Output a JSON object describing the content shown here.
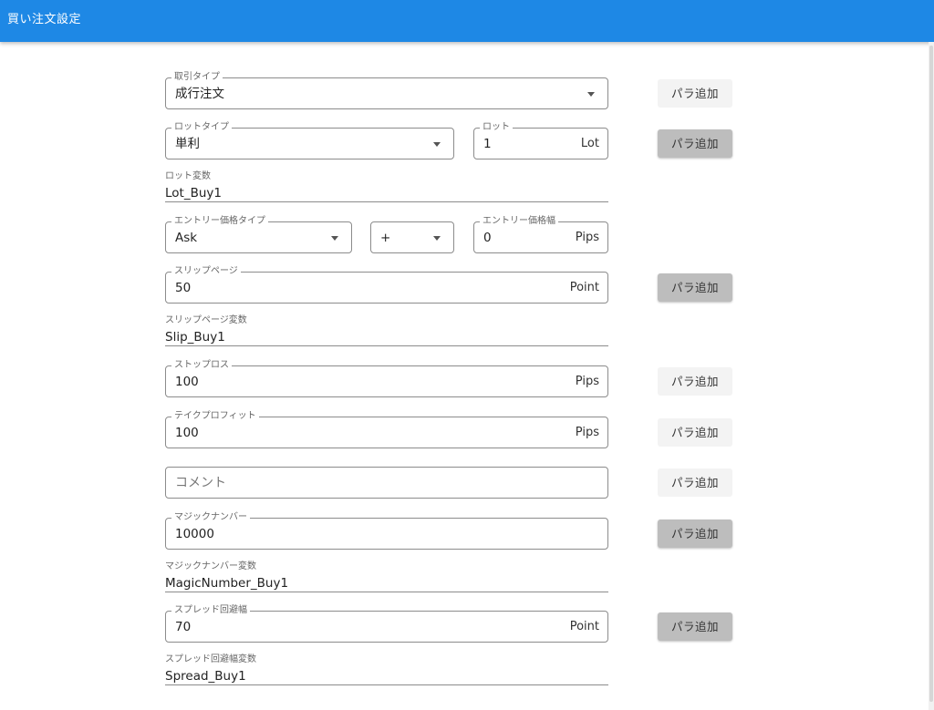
{
  "header": {
    "title": "買い注文設定"
  },
  "para_button_label": "パラ追加",
  "fields": {
    "trade_type": {
      "label": "取引タイプ",
      "value": "成行注文"
    },
    "lot_type": {
      "label": "ロットタイプ",
      "value": "単利"
    },
    "lot": {
      "label": "ロット",
      "value": "1",
      "suffix": "Lot"
    },
    "lot_variable": {
      "label": "ロット変数",
      "value": "Lot_Buy1"
    },
    "entry_price_type": {
      "label": "エントリー価格タイプ",
      "value": "Ask"
    },
    "sign": {
      "value": "+"
    },
    "entry_price_width": {
      "label": "エントリー価格幅",
      "value": "0",
      "suffix": "Pips"
    },
    "slippage": {
      "label": "スリップページ",
      "value": "50",
      "suffix": "Point"
    },
    "slippage_variable": {
      "label": "スリップページ変数",
      "value": "Slip_Buy1"
    },
    "stop_loss": {
      "label": "ストップロス",
      "value": "100",
      "suffix": "Pips"
    },
    "take_profit": {
      "label": "テイクプロフィット",
      "value": "100",
      "suffix": "Pips"
    },
    "comment": {
      "placeholder": "コメント"
    },
    "magic_number": {
      "label": "マジックナンバー",
      "value": "10000"
    },
    "magic_number_variable": {
      "label": "マジックナンバー変数",
      "value": "MagicNumber_Buy1"
    },
    "spread_avoid": {
      "label": "スプレッド回避幅",
      "value": "70",
      "suffix": "Point"
    },
    "spread_avoid_variable": {
      "label": "スプレッド回避幅変数",
      "value": "Spread_Buy1"
    }
  },
  "colors": {
    "appbar": "#1e88e5",
    "button_active": "#bdbdbd",
    "button_default": "#f3f3f3"
  }
}
